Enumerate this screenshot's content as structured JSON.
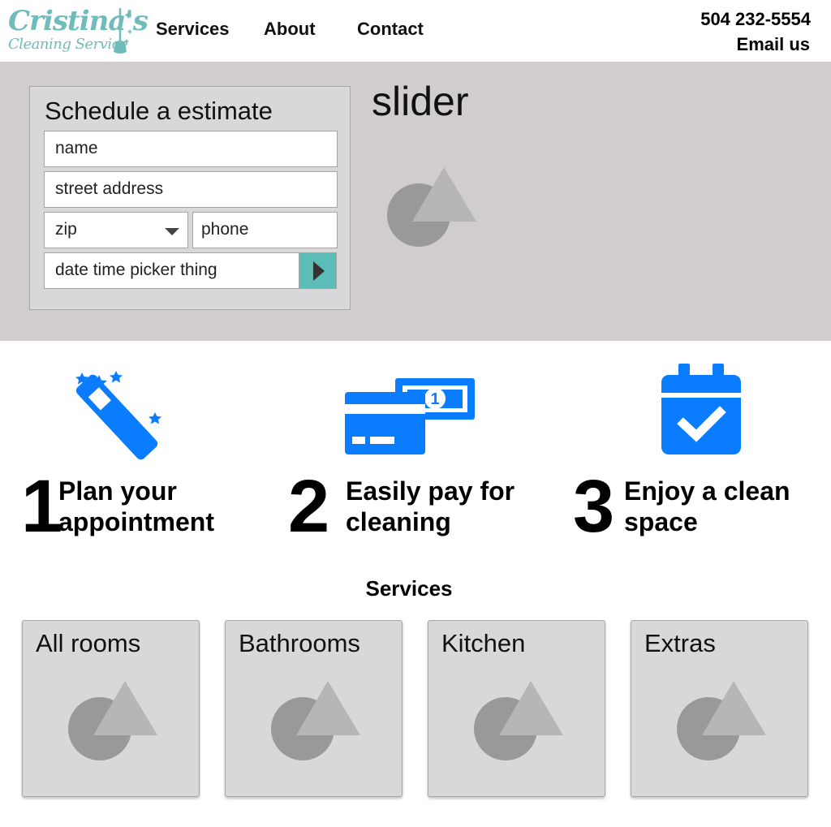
{
  "header": {
    "logo": {
      "main": "Cristina's",
      "sub": "Cleaning Service"
    },
    "nav": [
      {
        "label": "Services"
      },
      {
        "label": "About"
      },
      {
        "label": "Contact"
      }
    ],
    "phone": "504 232-5554",
    "email_label": "Email us"
  },
  "estimate_form": {
    "title": "Schedule a estimate",
    "name_placeholder": "name",
    "street_placeholder": "street address",
    "zip_placeholder": "zip",
    "phone_placeholder": "phone",
    "datetime_placeholder": "date time picker thing"
  },
  "slider": {
    "label": "slider"
  },
  "steps": [
    {
      "number": "1",
      "line1": "Plan your",
      "line2": "appointment",
      "icon": "magic-wand-icon"
    },
    {
      "number": "2",
      "line1": "Easily pay for",
      "line2": "cleaning",
      "icon": "payment-icon"
    },
    {
      "number": "3",
      "line1": "Enjoy a clean",
      "line2": "space",
      "icon": "calendar-check-icon"
    }
  ],
  "services": {
    "heading": "Services",
    "cards": [
      {
        "title": "All rooms"
      },
      {
        "title": "Bathrooms"
      },
      {
        "title": "Kitchen"
      },
      {
        "title": "Extras"
      }
    ]
  },
  "colors": {
    "accent": "#5bbcb8",
    "logo": "#6fbcbb",
    "icon_blue": "#0a7cff",
    "hero_bg": "#d0cdcc"
  }
}
